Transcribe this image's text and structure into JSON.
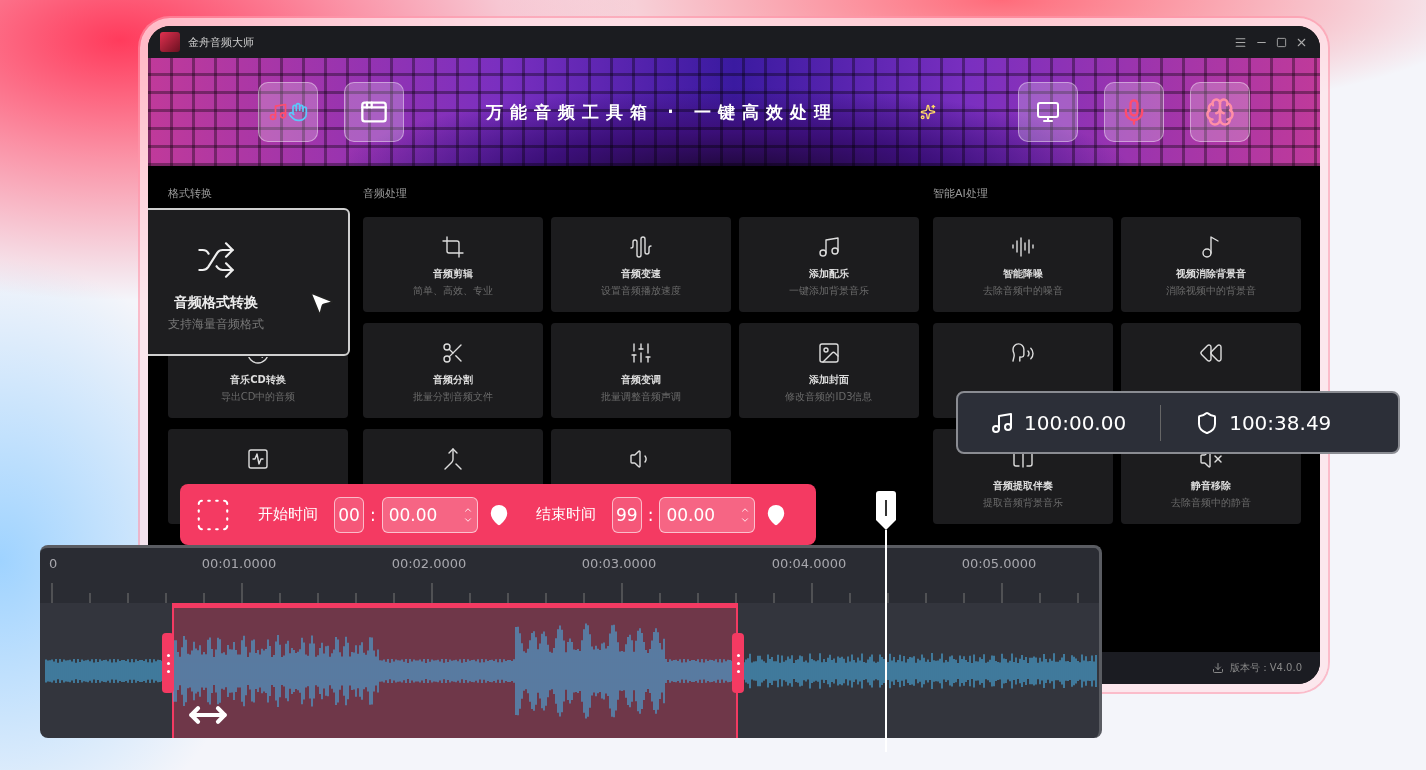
{
  "window": {
    "title": "金舟音频大师"
  },
  "banner": {
    "slogan": "万能音频工具箱 · 一键高效处理"
  },
  "sections": [
    {
      "title": "格式转换",
      "cards": [
        {
          "title": "音频格式转换",
          "subtitle": "支持海量音频格式",
          "hovered": true
        },
        {
          "title": "音乐CD转换",
          "subtitle": "导出CD中的音频",
          "hovered": false
        },
        {
          "hovered": false
        }
      ]
    },
    {
      "title": "音频处理",
      "cards": [
        {
          "title": "音频剪辑",
          "subtitle": "简单、高效、专业",
          "hovered": false
        },
        {
          "title": "音频变速",
          "subtitle": "设置音频播放速度",
          "hovered": false
        },
        {
          "title": "添加配乐",
          "subtitle": "一键添加背景音乐",
          "hovered": false
        },
        {
          "title": "音频分割",
          "subtitle": "批量分割音频文件",
          "hovered": false
        },
        {
          "title": "音频变调",
          "subtitle": "批量调整音频声调",
          "hovered": false
        },
        {
          "title": "添加封面",
          "subtitle": "修改音频的ID3信息",
          "hovered": false
        },
        {
          "hovered": false
        },
        {
          "hovered": false
        }
      ]
    },
    {
      "title": "智能AI处理",
      "cards": [
        {
          "title": "智能降噪",
          "subtitle": "去除音频中的噪音",
          "hovered": false
        },
        {
          "title": "视频消除背景音",
          "subtitle": "消除视频中的背景音",
          "hovered": false
        },
        {
          "hovered": false
        },
        {
          "hovered": false
        },
        {
          "title": "音频提取伴奏",
          "subtitle": "提取音频背景音乐",
          "hovered": false
        },
        {
          "title": "静音移除",
          "subtitle": "去除音频中的静音",
          "hovered": false
        }
      ]
    }
  ],
  "status_bar": {
    "version": "版本号：V4.0.0"
  },
  "time_panel": {
    "clip_time": "100:00.00",
    "marker_time": "100:38.49"
  },
  "trim_bar": {
    "start": {
      "label": "开始时间",
      "hours": "00",
      "separator": ":",
      "seconds": "00.00"
    },
    "end": {
      "label": "结束时间",
      "hours": "99",
      "separator": ":",
      "seconds": "00.00"
    }
  },
  "timeline": {
    "ticks": [
      "0",
      "00:01.0000",
      "00:02.0000",
      "00:03.0000",
      "00:04.0000",
      "00:05.0000"
    ]
  }
}
